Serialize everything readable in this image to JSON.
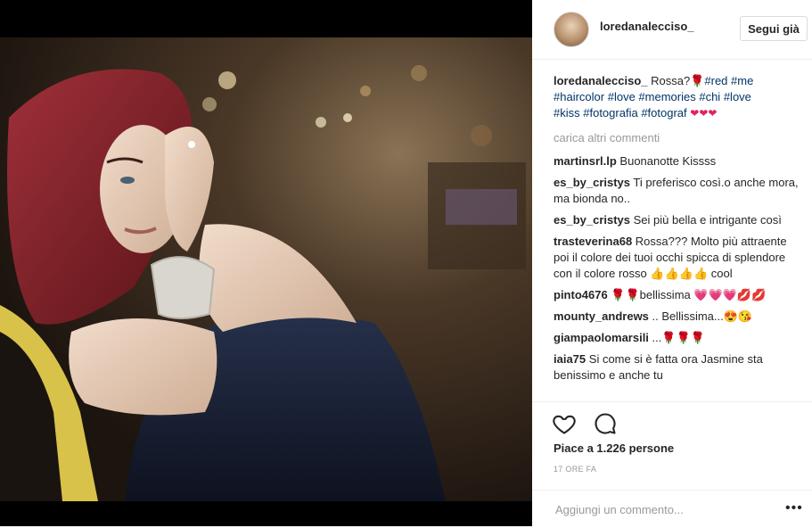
{
  "post": {
    "username": "loredanalecciso_",
    "follow_label": "Segui già",
    "caption_text": " Rossa?🌹",
    "caption_tags": [
      "#red",
      "#me",
      "#haircolor",
      "#love",
      "#memories",
      "#chi",
      "#love",
      "#kiss",
      "#fotografia",
      "#fotograf"
    ],
    "caption_emoji": "❤❤❤",
    "load_more": "carica altri commenti"
  },
  "comments": [
    {
      "user": "martinsrl.lp",
      "text": "Buonanotte Kissss"
    },
    {
      "user": "es_by_cristys",
      "text": "Ti preferisco così.o anche mora, ma bionda no.."
    },
    {
      "user": "es_by_cristys",
      "text": "Sei più bella e intrigante così"
    },
    {
      "user": "trasteverina68",
      "text": "Rossa??? Molto più attraente poi il colore dei tuoi occhi spicca di splendore con il colore rosso 👍👍👍👍 cool"
    },
    {
      "user": "pinto4676",
      "text": "🌹🌹bellissima 💗💗💗💋💋"
    },
    {
      "user": "mounty_andrews",
      "text": ".. Bellissima...😍😘"
    },
    {
      "user": "giampaolomarsili",
      "text": "...🌹🌹🌹"
    },
    {
      "user": "iaia75",
      "text": "Si come si è fatta ora Jasmine sta benissimo e anche tu"
    }
  ],
  "actions": {
    "likes": "Piace a 1.226 persone",
    "time": "17 ORE FA",
    "comment_placeholder": "Aggiungi un commento...",
    "more": "•••"
  },
  "colors": {
    "hashtag": "#003569",
    "border": "#efefef",
    "muted": "#999999"
  }
}
